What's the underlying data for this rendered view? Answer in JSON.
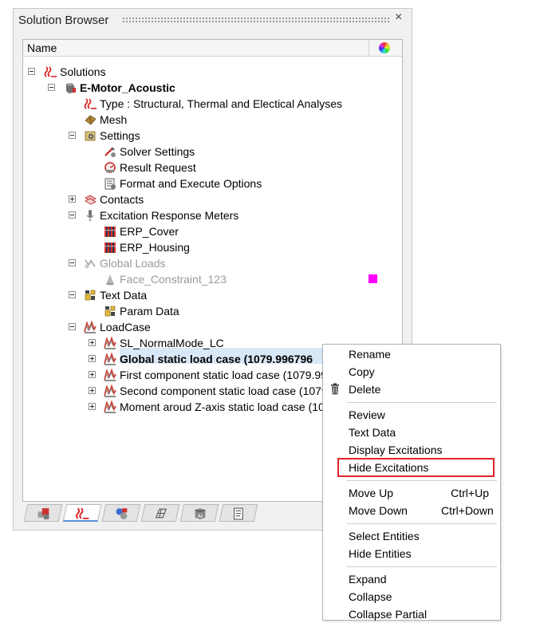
{
  "panel": {
    "title": "Solution Browser",
    "close_glyph": "×",
    "column_name": "Name",
    "color_column_icon": "color-wheel-icon"
  },
  "tree": [
    {
      "id": "solutions",
      "label": "Solutions",
      "level": 0,
      "expander": "minus",
      "icon": "solution-icon"
    },
    {
      "id": "emotor",
      "label": "E-Motor_Acoustic",
      "level": 1,
      "expander": "minus",
      "icon": "model-icon",
      "bold": true
    },
    {
      "id": "type",
      "label": "Type : Structural, Thermal and Electical Analyses",
      "level": 2,
      "icon": "solution-icon"
    },
    {
      "id": "mesh",
      "label": "Mesh",
      "level": 2,
      "icon": "mesh-icon"
    },
    {
      "id": "settings",
      "label": "Settings",
      "level": 2,
      "expander": "minus",
      "icon": "settings-icon"
    },
    {
      "id": "solver",
      "label": "Solver Settings",
      "level": 3,
      "icon": "solver-settings-icon"
    },
    {
      "id": "result",
      "label": "Result Request",
      "level": 3,
      "icon": "result-request-icon"
    },
    {
      "id": "format",
      "label": "Format and Execute Options",
      "level": 3,
      "icon": "format-execute-icon"
    },
    {
      "id": "contacts",
      "label": "Contacts",
      "level": 2,
      "expander": "plus",
      "icon": "contacts-icon"
    },
    {
      "id": "erm",
      "label": "Excitation Response Meters",
      "level": 2,
      "expander": "minus",
      "icon": "microphone-icon"
    },
    {
      "id": "erpcover",
      "label": "ERP_Cover",
      "level": 3,
      "icon": "erp-icon"
    },
    {
      "id": "erphousing",
      "label": "ERP_Housing",
      "level": 3,
      "icon": "erp-icon"
    },
    {
      "id": "globalloads",
      "label": "Global Loads",
      "level": 2,
      "expander": "minus",
      "icon": "global-loads-icon",
      "grey": true
    },
    {
      "id": "faceconstraint",
      "label": "Face_Constraint_123",
      "level": 3,
      "icon": "cone-icon",
      "grey": true,
      "color": "#ff00ff"
    },
    {
      "id": "textdata",
      "label": "Text Data",
      "level": 2,
      "expander": "minus",
      "icon": "text-data-icon"
    },
    {
      "id": "paramdata",
      "label": "Param Data",
      "level": 3,
      "icon": "text-data-icon"
    },
    {
      "id": "loadcase",
      "label": "LoadCase",
      "level": 2,
      "expander": "minus",
      "icon": "loadcase-icon"
    },
    {
      "id": "lc1",
      "label": "SL_NormalMode_LC",
      "level": 3,
      "expander": "plus",
      "icon": "loadcase-icon"
    },
    {
      "id": "lc2",
      "label": "Global static load case (1079.996796",
      "level": 3,
      "expander": "plus",
      "icon": "loadcase-icon",
      "bold": true,
      "selected": true
    },
    {
      "id": "lc3",
      "label": "First component static load case (1079.996",
      "level": 3,
      "expander": "plus",
      "icon": "loadcase-icon"
    },
    {
      "id": "lc4",
      "label": "Second component static load case (1079.",
      "level": 3,
      "expander": "plus",
      "icon": "loadcase-icon"
    },
    {
      "id": "lc5",
      "label": "Moment aroud Z-axis static load case (107",
      "level": 3,
      "expander": "plus",
      "icon": "loadcase-icon"
    }
  ],
  "tabs": [
    {
      "icon": "model-tab-icon"
    },
    {
      "icon": "solution-tab-icon",
      "active": true
    },
    {
      "icon": "analysis-tab-icon"
    },
    {
      "icon": "geometry-tab-icon"
    },
    {
      "icon": "library-tab-icon"
    },
    {
      "icon": "script-tab-icon"
    }
  ],
  "context_menu": {
    "groups": [
      [
        {
          "label": "Rename"
        },
        {
          "label": "Copy"
        },
        {
          "label": "Delete",
          "icon": "trash-icon"
        }
      ],
      [
        {
          "label": "Review"
        },
        {
          "label": "Text Data"
        },
        {
          "label": "Display Excitations"
        },
        {
          "label": "Hide Excitations",
          "highlighted": true
        }
      ],
      [
        {
          "label": "Move Up",
          "shortcut": "Ctrl+Up"
        },
        {
          "label": "Move Down",
          "shortcut": "Ctrl+Down"
        }
      ],
      [
        {
          "label": "Select Entities"
        },
        {
          "label": "Hide Entities"
        }
      ],
      [
        {
          "label": "Expand"
        },
        {
          "label": "Collapse"
        },
        {
          "label": "Collapse Partial"
        }
      ]
    ],
    "highlight_color": "#e0242c"
  }
}
